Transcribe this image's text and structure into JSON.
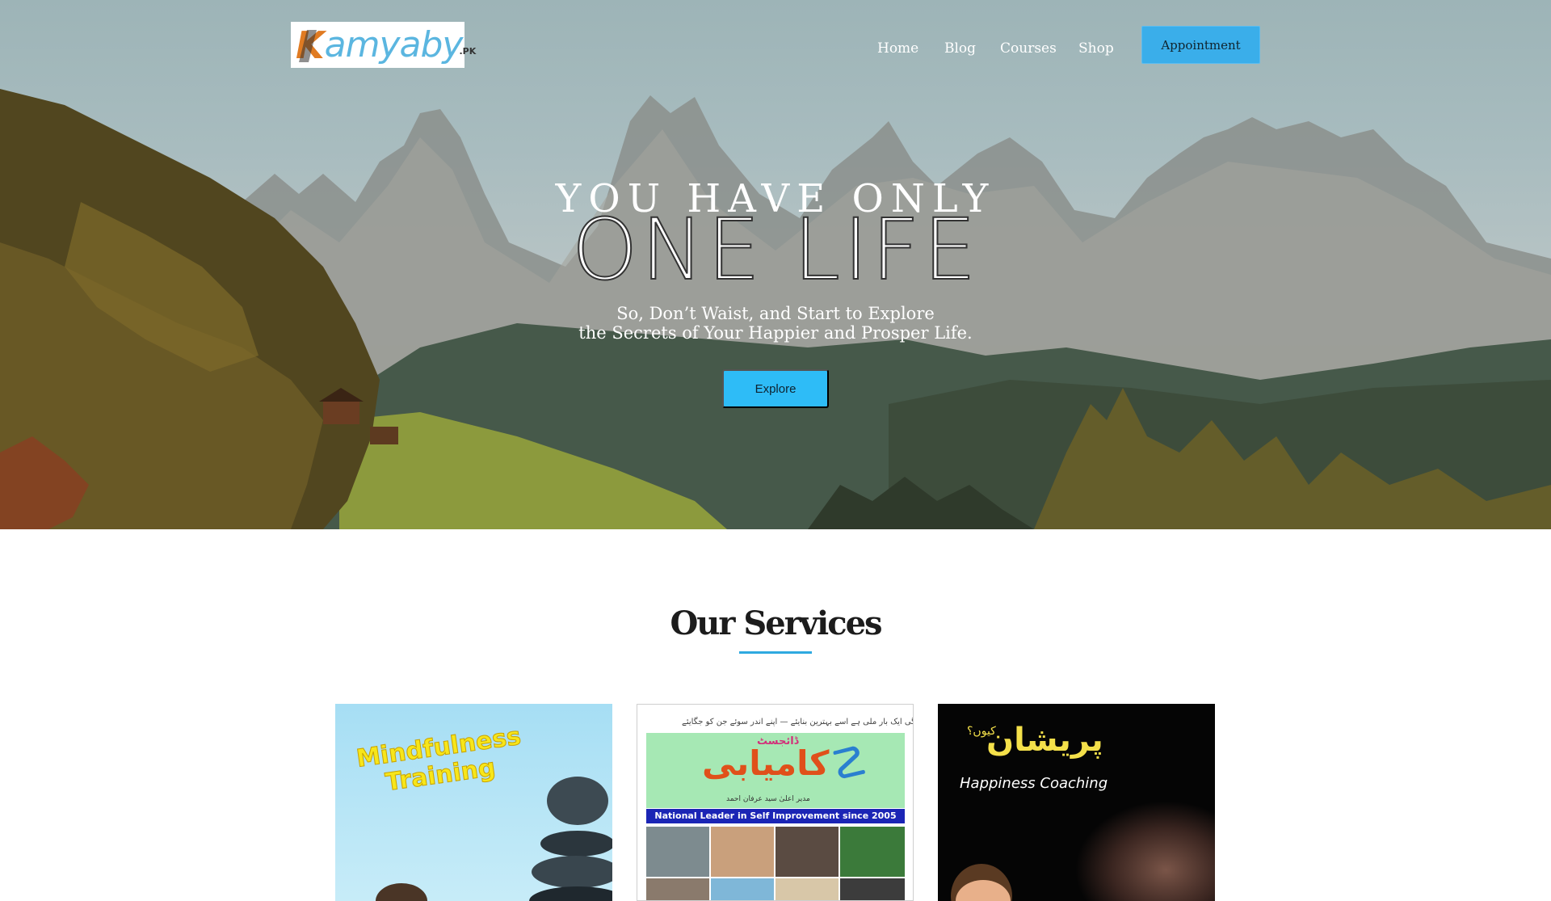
{
  "header": {
    "logo_text": "Kamyaby",
    "logo_tld": ".PK",
    "nav": [
      "Home",
      "Blog",
      "Courses",
      "Shop"
    ],
    "appointment_label": "Appointment"
  },
  "hero": {
    "line1": "YOU HAVE ONLY",
    "line2": "ONE LIFE",
    "subtitle_line1": "So, Don’t Waist, and Start to Explore",
    "subtitle_line2": "the Secrets of Your Happier and Prosper Life.",
    "explore_label": "Explore"
  },
  "services": {
    "title": "Our Services",
    "cards": [
      {
        "heading": "Mindfulness Training"
      },
      {
        "urdu_tagline": "زندگی ایک بار ملی ہے اسے بہترین بنایئے — اپنے اندر سوئے جن کو جگایئے",
        "title_urdu": "کامیابی",
        "digest_urdu": "ڈائجسٹ",
        "editor_urdu": "مدیر اعلیٰ سید عرفان احمد",
        "banner": "National Leader in Self Improvement since 2005"
      },
      {
        "title_urdu": "پریشان",
        "why_urdu": "کیوں؟",
        "subtitle": "Happiness Coaching"
      }
    ]
  },
  "colors": {
    "accent": "#2ebcf7",
    "appointment_bg": "#3aaeea",
    "underline": "#2ea9e0",
    "mindfulness_text": "#f7e61a"
  }
}
